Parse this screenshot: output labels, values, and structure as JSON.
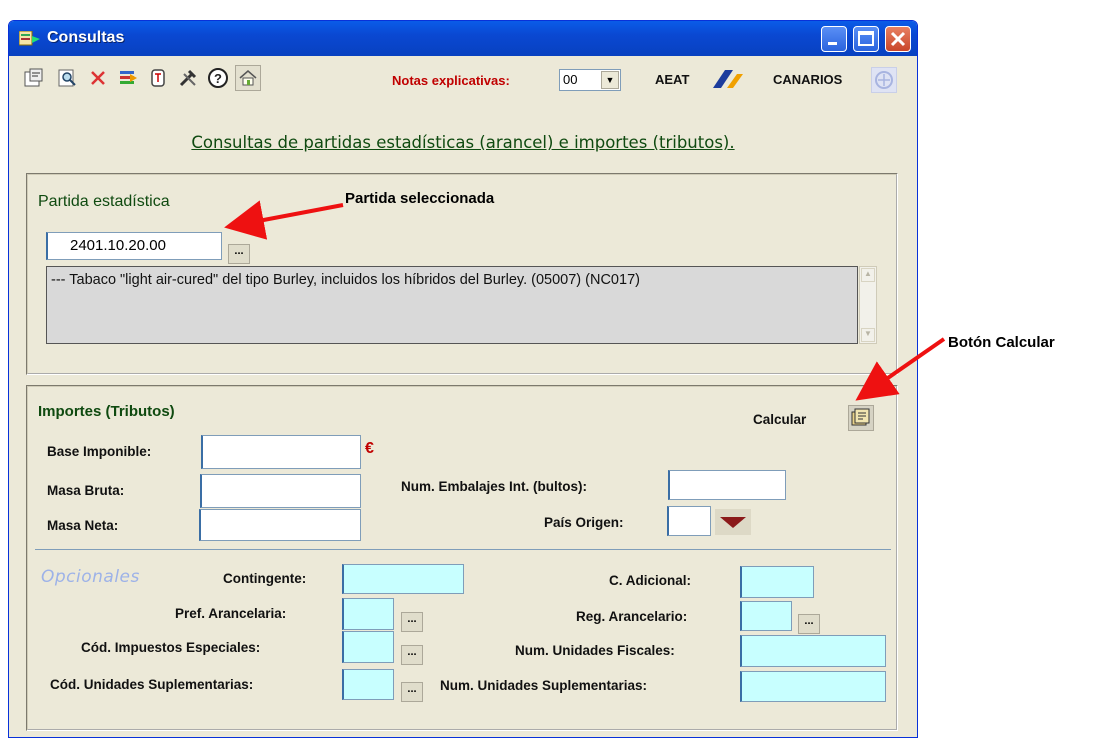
{
  "window": {
    "title": "Consultas"
  },
  "toolbar": {
    "icons": [
      "properties-icon",
      "search-icon",
      "delete-icon",
      "list-icon",
      "tribute-icon",
      "tools-icon",
      "help-icon",
      "home-icon"
    ],
    "notas_label": "Notas explicativas:",
    "notas_value": "00",
    "aeat_label": "AEAT",
    "canarios_label": "CANARIOS"
  },
  "heading": "Consultas de partidas estadísticas (arancel) e importes (tributos).",
  "partida": {
    "group_title": "Partida estadística",
    "value": "2401.10.20.00",
    "ellipsis": "...",
    "description": "--- Tabaco \"light air-cured\" del tipo Burley, incluidos los híbridos del Burley. (05007) (NC017)"
  },
  "annotations": {
    "partida": "Partida seleccionada",
    "calcular": "Botón Calcular"
  },
  "importes": {
    "group_title": "Importes (Tributos)",
    "calcular_label": "Calcular",
    "base_imponible_label": "Base Imponible:",
    "currency": "€",
    "masa_bruta_label": "Masa Bruta:",
    "masa_neta_label": "Masa Neta:",
    "num_embalajes_label": "Num. Embalajes Int. (bultos):",
    "pais_origen_label": "País Origen:"
  },
  "opcionales": {
    "title": "Opcionales",
    "contingente_label": "Contingente:",
    "c_adicional_label": "C. Adicional:",
    "pref_arancelaria_label": "Pref. Arancelaria:",
    "reg_arancelario_label": "Reg. Arancelario:",
    "cod_impuestos_label": "Cód. Impuestos Especiales:",
    "num_unidades_fiscales_label": "Num. Unidades Fiscales:",
    "cod_unidades_sup_label": "Cód. Unidades Suplementarias:",
    "num_unidades_sup_label": "Num. Unidades Suplementarias:",
    "ellipsis": "..."
  },
  "colors": {
    "accent_red": "#C00000",
    "heading_green": "#0F4A10",
    "optional_field": "#C8FFFF",
    "title_blue": "#0A48D2"
  }
}
